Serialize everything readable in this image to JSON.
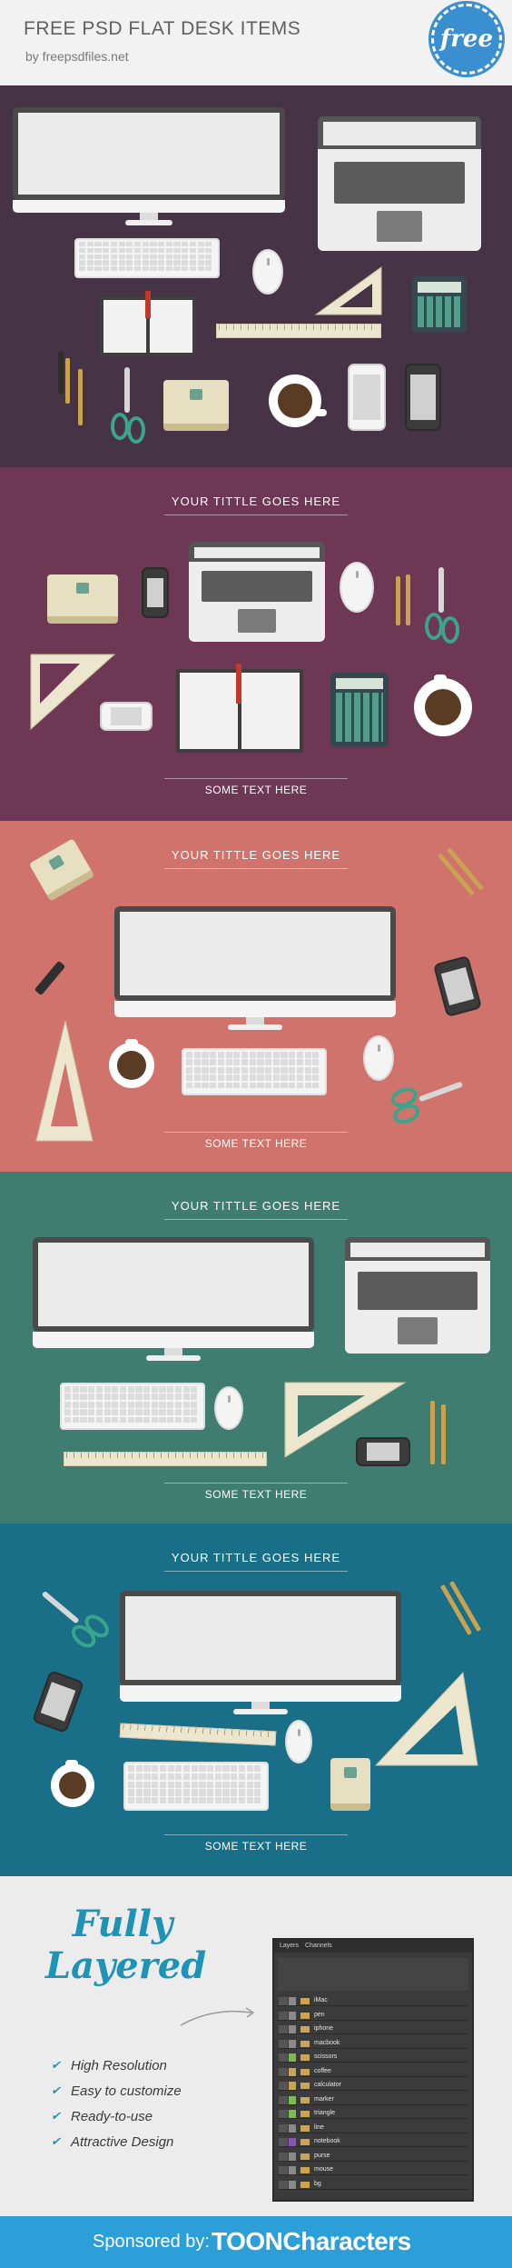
{
  "header": {
    "title": "FREE PSD FLAT DESK ITEMS",
    "subtitle": "by freepsdfiles.net",
    "badge": "free"
  },
  "panels": [
    {
      "color": "#473346"
    },
    {
      "color": "#6e3754",
      "title": "YOUR TITTLE GOES HERE",
      "footer": "SOME TEXT HERE"
    },
    {
      "color": "#d1736d",
      "title": "YOUR TITTLE GOES HERE",
      "footer": "SOME TEXT HERE"
    },
    {
      "color": "#3f7d70",
      "title": "YOUR TITTLE GOES HERE",
      "footer": "SOME TEXT HERE"
    },
    {
      "color": "#196f88",
      "title": "YOUR TITTLE GOES HERE",
      "footer": "SOME TEXT HERE"
    }
  ],
  "layered": {
    "heading_line1": "Fully",
    "heading_line2": "Layered",
    "features": [
      "High Resolution",
      "Easy to customize",
      "Ready-to-use",
      "Attractive Design"
    ]
  },
  "layers_panel": {
    "tab1": "Layers",
    "tab2": "Channels",
    "layers": [
      {
        "name": "iMac",
        "color": "#8a8a8a"
      },
      {
        "name": "pen",
        "color": "#8a8a8a"
      },
      {
        "name": "iphone",
        "color": "#8a8a8a"
      },
      {
        "name": "macbook",
        "color": "#8a8a8a"
      },
      {
        "name": "scissors",
        "color": "#7dbb4f"
      },
      {
        "name": "coffee",
        "color": "#c9a456"
      },
      {
        "name": "calculator",
        "color": "#c9a456"
      },
      {
        "name": "marker",
        "color": "#7dbb4f"
      },
      {
        "name": "triangle",
        "color": "#7dbb4f"
      },
      {
        "name": "line",
        "color": "#8a8a8a"
      },
      {
        "name": "notebook",
        "color": "#8a56b3"
      },
      {
        "name": "purse",
        "color": "#8a8a8a"
      },
      {
        "name": "mouse",
        "color": "#8a8a8a"
      },
      {
        "name": "bg",
        "color": "#8a8a8a"
      }
    ]
  },
  "sponsor": {
    "by": "Sponsored by:",
    "brand": "TOONCharacters"
  }
}
